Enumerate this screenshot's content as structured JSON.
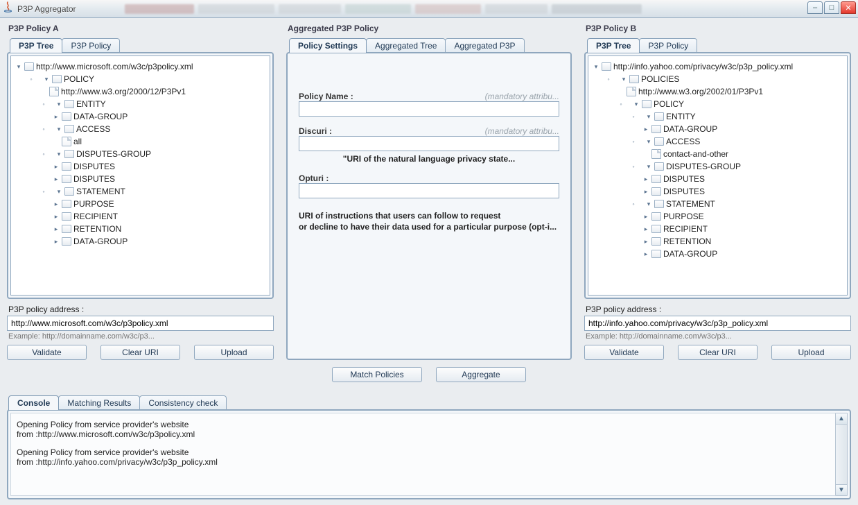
{
  "window": {
    "title": "P3P Aggregator"
  },
  "policyA": {
    "title": "P3P Policy A",
    "tabs": {
      "tree": "P3P Tree",
      "policy": "P3P Policy"
    },
    "tree": {
      "root": "http://www.microsoft.com/w3c/p3policy.xml",
      "policy": "POLICY",
      "version": "http://www.w3.org/2000/12/P3Pv1",
      "entity": "ENTITY",
      "entity_datagroup": "DATA-GROUP",
      "access": "ACCESS",
      "access_all": "all",
      "disputesgroup": "DISPUTES-GROUP",
      "disputes1": "DISPUTES",
      "disputes2": "DISPUTES",
      "statement": "STATEMENT",
      "purpose": "PURPOSE",
      "recipient": "RECIPIENT",
      "retention": "RETENTION",
      "stmt_datagroup": "DATA-GROUP"
    },
    "addr_label": "P3P policy address :",
    "addr_value": "http://www.microsoft.com/w3c/p3policy.xml",
    "addr_hint": "Example: http://domainname.com/w3c/p3...",
    "buttons": {
      "validate": "Validate",
      "clear": "Clear URI",
      "upload": "Upload"
    }
  },
  "agg": {
    "title": "Aggregated P3P Policy",
    "tabs": {
      "settings": "Policy Settings",
      "tree": "Aggregated Tree",
      "p3p": "Aggregated P3P"
    },
    "fields": {
      "name_label": "Policy Name :",
      "name_mand": "(mandatory attribu...",
      "disc_label": "Discuri :",
      "disc_mand": "(mandatory attribu...",
      "disc_caption": "\"URI of the natural language privacy state...",
      "opt_label": "Opturi :",
      "desc_line1": "URI of instructions that users can follow to request",
      "desc_line2": "or decline to have their data used for a particular purpose (opt-i..."
    },
    "buttons": {
      "match": "Match Policies",
      "aggregate": "Aggregate"
    }
  },
  "policyB": {
    "title": "P3P Policy B",
    "tabs": {
      "tree": "P3P Tree",
      "policy": "P3P Policy"
    },
    "tree": {
      "root": "http://info.yahoo.com/privacy/w3c/p3p_policy.xml",
      "policies": "POLICIES",
      "version": "http://www.w3.org/2002/01/P3Pv1",
      "policy": "POLICY",
      "entity": "ENTITY",
      "entity_datagroup": "DATA-GROUP",
      "access": "ACCESS",
      "access_item": "contact-and-other",
      "disputesgroup": "DISPUTES-GROUP",
      "disputes1": "DISPUTES",
      "disputes2": "DISPUTES",
      "statement": "STATEMENT",
      "purpose": "PURPOSE",
      "recipient": "RECIPIENT",
      "retention": "RETENTION",
      "stmt_datagroup": "DATA-GROUP"
    },
    "addr_label": "P3P policy address :",
    "addr_value": "http://info.yahoo.com/privacy/w3c/p3p_policy.xml",
    "addr_hint": "Example: http://domainname.com/w3c/p3...",
    "buttons": {
      "validate": "Validate",
      "clear": "Clear URI",
      "upload": "Upload"
    }
  },
  "bottom": {
    "tabs": {
      "console": "Console",
      "matching": "Matching Results",
      "consistency": "Consistency check"
    },
    "lines": {
      "l1": "Opening Policy from service provider's website",
      "l2": "from  :http://www.microsoft.com/w3c/p3policy.xml",
      "l3": "Opening Policy from service provider's website",
      "l4": "from  :http://info.yahoo.com/privacy/w3c/p3p_policy.xml"
    }
  }
}
